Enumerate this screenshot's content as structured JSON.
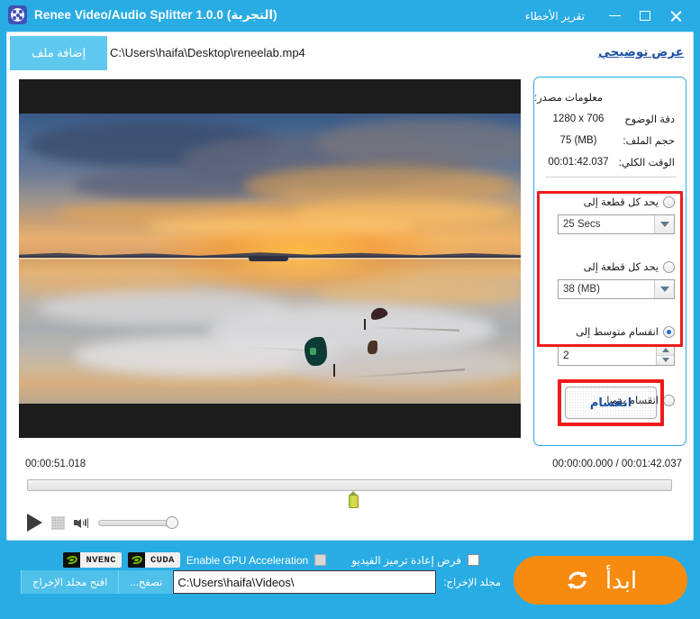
{
  "window": {
    "title": "Renee Video/Audio Splitter 1.0.0 (التجربة)",
    "bug_report": "تقرير الأخطاء",
    "minimize_label": "—",
    "maximize_label": "□",
    "close_label": "✕",
    "app_icon": "film-reel-icon",
    "accent_color": "#29ace3"
  },
  "toolbar": {
    "add_file_label": "إضافة ملف",
    "file_path": "C:\\Users\\haifa\\Desktop\\reneelab.mp4",
    "demo_link": "عرض توضيحي"
  },
  "preview": {
    "alt": "لقطة فيديو: غروب الشمس فوق الماء مع طائرات ورقية"
  },
  "player": {
    "current_marker_time": "00:00:51.018",
    "position_and_duration": "00:00:00.000 / 00:01:42.037",
    "play_label": "تشغيل",
    "stop_label": "إيقاف",
    "volume_value": 100,
    "marker_position_percent": 49.7
  },
  "source_info": {
    "heading": "معلومات مصدر:",
    "rows": [
      {
        "label": "دقة الوضوح",
        "value": "1280 x 706"
      },
      {
        "label": "حجم الملف:",
        "value": "75 (MB)"
      },
      {
        "label": "الوقت الكلي:",
        "value": "00:01:42.037"
      }
    ]
  },
  "split_options": {
    "options": [
      {
        "label": "يحد كل قطعة إلى",
        "selected": false,
        "control": "combo",
        "value": "25 Secs",
        "name": "limit-by-duration"
      },
      {
        "label": "يحد كل قطعة إلى",
        "selected": false,
        "control": "combo",
        "value": "38 (MB)",
        "name": "limit-by-size"
      },
      {
        "label": "انقسام متوسط إلى",
        "selected": true,
        "control": "spinner",
        "value": "2",
        "name": "average-split"
      },
      {
        "label": "انقسام يدويا",
        "selected": false,
        "control": "none",
        "value": "",
        "name": "manual-split"
      }
    ],
    "split_button_label": "انقسام",
    "highlight_color": "#ee1b1b"
  },
  "footer": {
    "force_reencode_label": "فرض إعادة ترميز الفيديو",
    "force_reencode_checked": false,
    "gpu_accel_label": "Enable GPU Acceleration",
    "gpu_accel_checked": false,
    "gpu_accel_disabled": true,
    "cuda_badge": "CUDA",
    "nvenc_badge": "NVENC",
    "output_folder_label": "مجلد الإخراج:",
    "output_folder_value": "C:\\Users\\haifa\\Videos\\",
    "browse_label": "تصفح...",
    "open_output_label": "افتح مجلد الإخراج",
    "start_label": "ابدأ",
    "start_color": "#f78b0f"
  }
}
